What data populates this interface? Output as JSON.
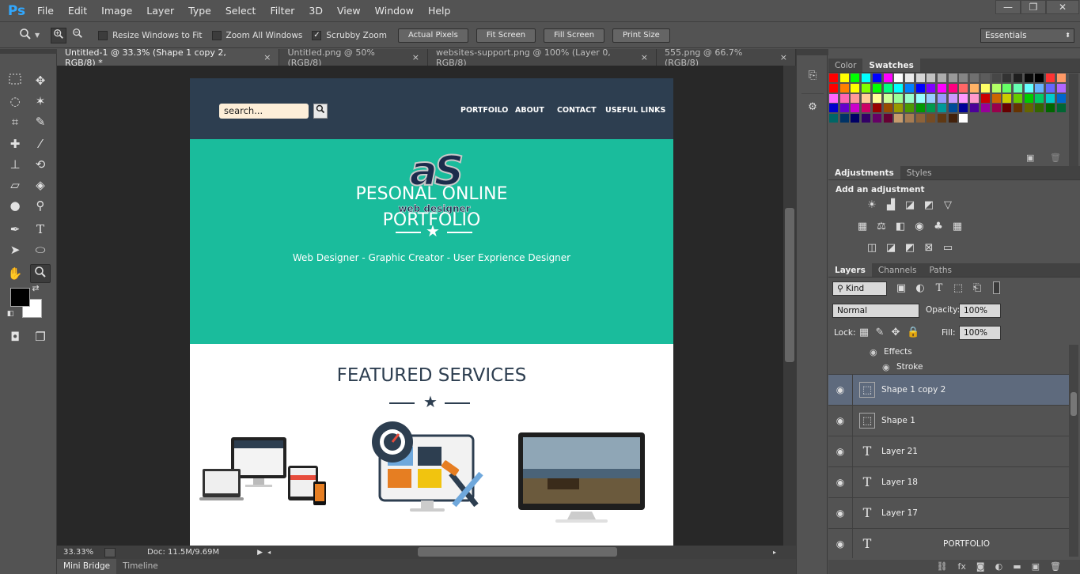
{
  "app": {
    "logo": "Ps"
  },
  "menu": [
    "File",
    "Edit",
    "Image",
    "Layer",
    "Type",
    "Select",
    "Filter",
    "3D",
    "View",
    "Window",
    "Help"
  ],
  "window_controls": {
    "minimize": "—",
    "restore": "❐",
    "close": "✕"
  },
  "options": {
    "resize_windows": "Resize Windows to Fit",
    "zoom_all": "Zoom All Windows",
    "scrubby": "Scrubby Zoom",
    "actual_pixels": "Actual Pixels",
    "fit_screen": "Fit Screen",
    "fill_screen": "Fill Screen",
    "print_size": "Print Size",
    "workspace": "Essentials"
  },
  "tabs": [
    {
      "label": "Untitled-1 @ 33.3% (Shape 1 copy 2, RGB/8) *"
    },
    {
      "label": "Untitled.png @ 50% (RGB/8)"
    },
    {
      "label": "websites-support.png @ 100% (Layer 0, RGB/8)"
    },
    {
      "label": "555.png @ 66.7% (RGB/8)"
    }
  ],
  "tab_close": "×",
  "document": {
    "search_text": "search...",
    "nav": [
      "PORTFOILO",
      "ABOUT",
      "CONTACT",
      "USEFUL LINKS"
    ],
    "logo_text": "aS",
    "logo_sub": "web designer",
    "hero_title_1": "PESONAL ONLINE",
    "hero_title_2": "PORTFOLIO",
    "hero_sub": "Web Designer - Graphic Creator - User Exprience Designer",
    "featured": "FEATURED SERVICES"
  },
  "status": {
    "zoom": "33.33%",
    "doc": "Doc: 11.5M/9.69M"
  },
  "bottom_tabs": [
    "Mini Bridge",
    "Timeline"
  ],
  "color_panel": {
    "tabs": [
      "Color",
      "Swatches"
    ]
  },
  "adjust_panel": {
    "tabs": [
      "Adjustments",
      "Styles"
    ],
    "label": "Add an adjustment"
  },
  "layers_panel": {
    "tabs": [
      "Layers",
      "Channels",
      "Paths"
    ],
    "kind": "Kind",
    "blend": "Normal",
    "opacity_label": "Opacity:",
    "opacity": "100%",
    "lock_label": "Lock:",
    "fill_label": "Fill:",
    "fill": "100%",
    "effects": "Effects",
    "stroke": "Stroke",
    "layers": [
      {
        "name": "Shape 1 copy 2",
        "type": "shape",
        "selected": true
      },
      {
        "name": "Shape 1",
        "type": "shape",
        "selected": false
      },
      {
        "name": "Layer 21",
        "type": "text",
        "selected": false
      },
      {
        "name": "Layer 18",
        "type": "text",
        "selected": false
      },
      {
        "name": "Layer 17",
        "type": "text",
        "selected": false
      },
      {
        "name": "PORTFOLIO",
        "type": "text",
        "selected": false
      }
    ]
  },
  "swatch_colors": [
    [
      "#ff0000",
      "#ffff00",
      "#00ff00",
      "#00ffff",
      "#0000ff",
      "#ff00ff",
      "#ffffff",
      "#ebebeb",
      "#d6d6d6",
      "#c2c2c2",
      "#adadad",
      "#999999",
      "#858585",
      "#707070",
      "#5c5c5c",
      "#474747",
      "#333333",
      "#1f1f1f",
      "#0a0a0a",
      "#000000",
      "#ff3333",
      "#ff9966"
    ],
    [
      "#ff0000",
      "#ff8000",
      "#ffff00",
      "#80ff00",
      "#00ff00",
      "#00ff80",
      "#00ffff",
      "#0080ff",
      "#0000ff",
      "#8000ff",
      "#ff00ff",
      "#ff0080",
      "#ff6666",
      "#ffb266",
      "#ffff66",
      "#b2ff66",
      "#66ff66",
      "#66ffb2",
      "#66ffff",
      "#66b2ff",
      "#6666ff",
      "#b266ff"
    ],
    [
      "#ff66ff",
      "#ff66b2",
      "#ff9999",
      "#ffcc99",
      "#ffff99",
      "#ccff99",
      "#99ff99",
      "#99ffcc",
      "#99ffff",
      "#99ccff",
      "#9999ff",
      "#cc99ff",
      "#ff99ff",
      "#ff99cc",
      "#cc0000",
      "#cc6600",
      "#cccc00",
      "#66cc00",
      "#00cc00",
      "#00cc66",
      "#00cccc",
      "#0066cc"
    ],
    [
      "#0000cc",
      "#6600cc",
      "#cc00cc",
      "#cc0066",
      "#990000",
      "#994c00",
      "#999900",
      "#4c9900",
      "#009900",
      "#00994c",
      "#009999",
      "#004c99",
      "#000099",
      "#4c0099",
      "#990099",
      "#99004c",
      "#660000",
      "#663300",
      "#666600",
      "#336600",
      "#006600",
      "#006633"
    ],
    [
      "#006666",
      "#003366",
      "#000066",
      "#330066",
      "#660066",
      "#660033",
      "#c69c6d",
      "#a67c52",
      "#8c6239",
      "#754c24",
      "#603913",
      "#42210b",
      "#ffffff"
    ]
  ]
}
